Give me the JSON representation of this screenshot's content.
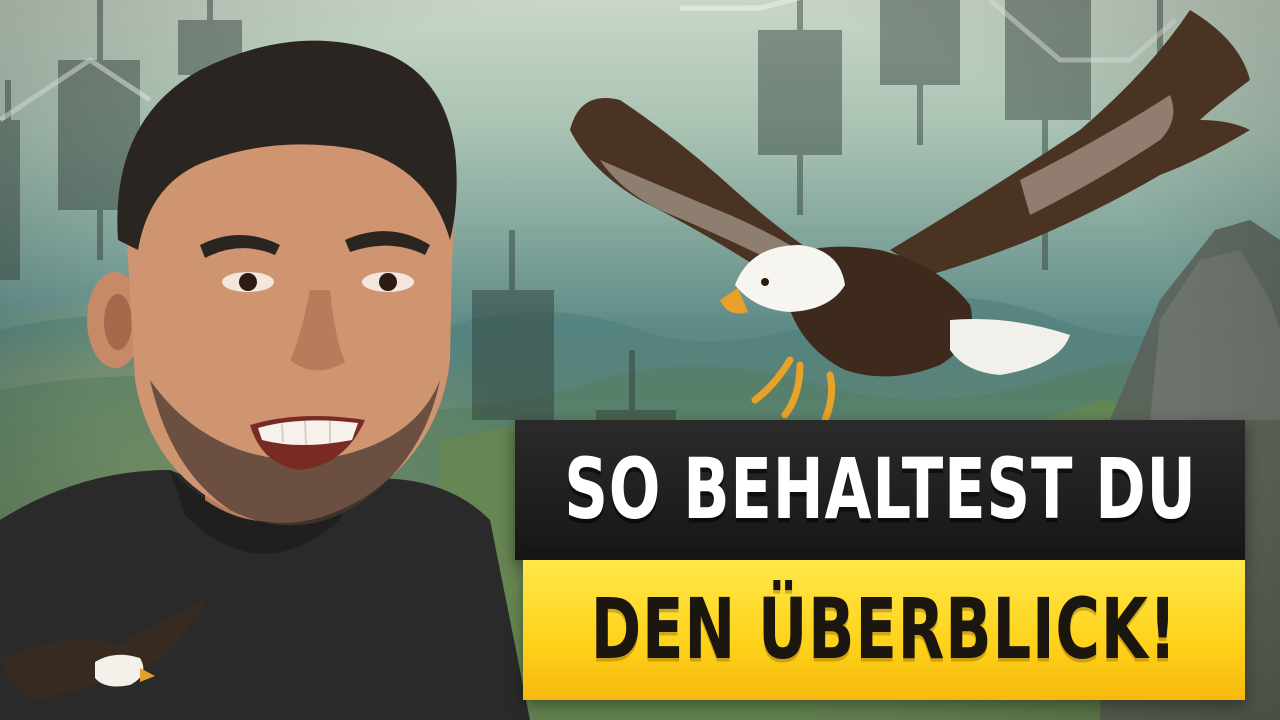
{
  "headline": {
    "line1": "SO BEHALTEST DU",
    "line2": "DEN ÜBERBLICK!"
  },
  "colors": {
    "headline_dark_bg": "#1d1d1d",
    "headline_yellow_bg": "#ffd21a",
    "headline_light_text": "#ffffff",
    "headline_dark_text": "#1b1710"
  },
  "scene": {
    "subjects": [
      "person",
      "bald-eagle",
      "small-eagle",
      "candlestick-shapes",
      "mountains"
    ]
  }
}
